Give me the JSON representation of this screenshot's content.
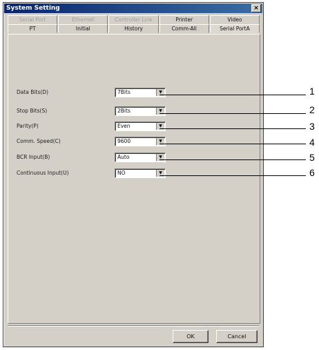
{
  "window": {
    "title": "System Setting",
    "close_label": "×"
  },
  "tabs": {
    "back_row": [
      {
        "label": "Serial Port",
        "disabled": true
      },
      {
        "label": "Ethernet",
        "disabled": true
      },
      {
        "label": "Controller Link",
        "disabled": true
      },
      {
        "label": "Printer",
        "disabled": false
      },
      {
        "label": "Video",
        "disabled": false
      }
    ],
    "front_row": [
      {
        "label": "PT"
      },
      {
        "label": "Initial"
      },
      {
        "label": "History"
      },
      {
        "label": "Comm-All"
      },
      {
        "label": "Serial PortA",
        "active": true
      }
    ]
  },
  "settings": [
    {
      "label": "Data Bits(D)",
      "value": "7Bits",
      "callout": "1"
    },
    {
      "label": "Stop Bits(S)",
      "value": "2Bits",
      "callout": "2"
    },
    {
      "label": "Parity(P)",
      "value": "Even",
      "callout": "3"
    },
    {
      "label": "Comm. Speed(C)",
      "value": "9600",
      "callout": "4"
    },
    {
      "label": "BCR Input(B)",
      "value": "Auto",
      "callout": "5"
    },
    {
      "label": "Continuous Input(U)",
      "value": "NO",
      "callout": "6"
    }
  ],
  "buttons": {
    "ok": "OK",
    "cancel": "Cancel"
  }
}
